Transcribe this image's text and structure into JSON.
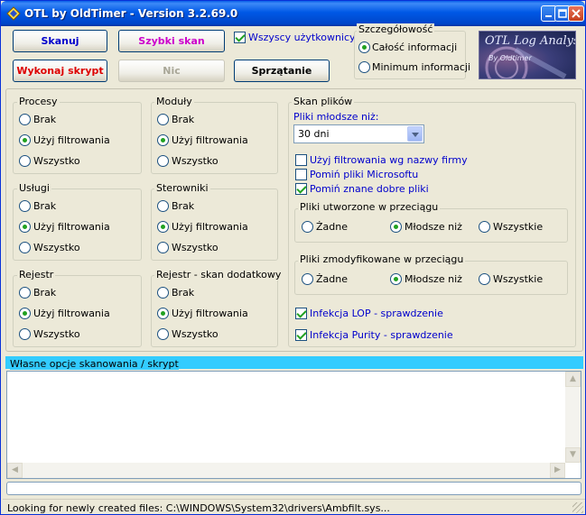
{
  "window": {
    "title": "OTL by OldTimer - Version 3.2.69.0"
  },
  "buttons": {
    "scan": "Skanuj",
    "quick_scan": "Szybki skan",
    "run_script": "Wykonaj skrypt",
    "nothing": "Nic",
    "cleanup": "Sprzątanie"
  },
  "colors": {
    "scan": "#0000cc",
    "quick_scan": "#cc00cc",
    "run_script": "#dd0000",
    "nothing_disabled": "#a8a697"
  },
  "all_users": {
    "label": "Wszyscy użytkownicy",
    "checked": true
  },
  "detail": {
    "title": "Szczegółowość",
    "options": [
      "Całość informacji",
      "Minimum informacji"
    ],
    "selected": 0
  },
  "logo": {
    "line1": "OTL Log Analysis",
    "line2": "By Oldtimer"
  },
  "groups": {
    "processes": {
      "title": "Procesy",
      "options": [
        "Brak",
        "Użyj filtrowania",
        "Wszystko"
      ],
      "selected": 1
    },
    "modules": {
      "title": "Moduły",
      "options": [
        "Brak",
        "Użyj filtrowania",
        "Wszystko"
      ],
      "selected": 1
    },
    "services": {
      "title": "Usługi",
      "options": [
        "Brak",
        "Użyj filtrowania",
        "Wszystko"
      ],
      "selected": 1
    },
    "drivers": {
      "title": "Sterowniki",
      "options": [
        "Brak",
        "Użyj filtrowania",
        "Wszystko"
      ],
      "selected": 1
    },
    "registry": {
      "title": "Rejestr",
      "options": [
        "Brak",
        "Użyj filtrowania",
        "Wszystko"
      ],
      "selected": 1
    },
    "registry_extra": {
      "title": "Rejestr - skan dodatkowy",
      "options": [
        "Brak",
        "Użyj filtrowania",
        "Wszystko"
      ],
      "selected": 1
    }
  },
  "file_scan": {
    "title": "Skan plików",
    "younger_label": "Pliki młodsze niż:",
    "younger_value": "30 dni",
    "use_company_filter": {
      "label": "Użyj filtrowania wg nazwy firmy",
      "checked": false
    },
    "skip_microsoft": {
      "label": "Pomiń pliki Microsoftu",
      "checked": false
    },
    "skip_known_good": {
      "label": "Pomiń znane dobre pliki",
      "checked": true
    },
    "created": {
      "title": "Pliki utworzone w przeciągu",
      "options": [
        "Żadne",
        "Młodsze niż",
        "Wszystkie"
      ],
      "selected": 1
    },
    "modified": {
      "title": "Pliki zmodyfikowane w przeciągu",
      "options": [
        "Żadne",
        "Młodsze niż",
        "Wszystkie"
      ],
      "selected": 1
    },
    "lop_check": {
      "label": "Infekcja LOP - sprawdzenie",
      "checked": true
    },
    "purity_check": {
      "label": "Infekcja Purity - sprawdzenie",
      "checked": true
    }
  },
  "custom_scan": {
    "title": "Własne opcje skanowania / skrypt",
    "value": ""
  },
  "status": {
    "text": "Looking for newly created files: C:\\WINDOWS\\System32\\drivers\\Ambfilt.sys..."
  }
}
